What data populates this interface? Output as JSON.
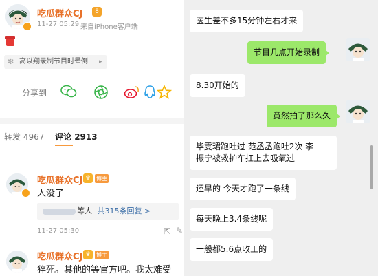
{
  "weibo": {
    "post": {
      "username": "吃瓜群众CJ",
      "level_badge": "8",
      "time": "11-27 05:29",
      "source": "来自iPhone客户端",
      "topic_pill": "高以翔录制节目时晕倒",
      "share_label": "分享到",
      "share_icons": [
        "wechat-icon",
        "moments-icon",
        "weibo-icon",
        "qq-icon",
        "qzone-star-icon"
      ]
    },
    "tabs": {
      "repost_label": "转发",
      "repost_count": "4967",
      "comment_label": "评论",
      "comment_count": "2913"
    },
    "comments": [
      {
        "username": "吃瓜群众CJ",
        "badge": "博主",
        "text": "人没了",
        "replies_text": "等人",
        "replies_link": "共315条回复 >",
        "time": "11-27 05:30"
      },
      {
        "username": "吃瓜群众CJ",
        "badge": "博主",
        "text": "猝死。其他的等官方吧。我太难受了。"
      }
    ]
  },
  "chat": {
    "messages": [
      {
        "side": "left",
        "text": "医生差不多15分钟左右才来"
      },
      {
        "side": "right",
        "text": "节目几点开始录制"
      },
      {
        "side": "left",
        "text": "8.30开始的"
      },
      {
        "side": "right",
        "text": "竟然拍了那么久"
      },
      {
        "side": "left",
        "line1": "毕雯珺跑吐过  范丞丞跑吐2次  李",
        "line2": "振宁被救护车扛上去吸氧过"
      },
      {
        "side": "left",
        "text": "还早的 今天才跑了一条线"
      },
      {
        "side": "left",
        "text": "每天晚上3.4条线呢"
      },
      {
        "side": "left",
        "text": "一般都5.6点收工的"
      }
    ]
  },
  "colors": {
    "username": "#e8722a",
    "bubble_green": "#9ce86a",
    "chat_bg": "#efefef"
  }
}
